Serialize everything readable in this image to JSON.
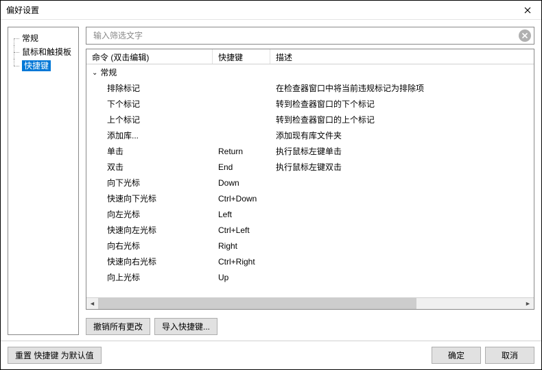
{
  "window": {
    "title": "偏好设置"
  },
  "sidebar": {
    "items": [
      {
        "label": "常规"
      },
      {
        "label": "鼠标和触摸板"
      },
      {
        "label": "快捷键"
      }
    ],
    "selected_index": 2
  },
  "search": {
    "placeholder": "输入筛选文字",
    "value": ""
  },
  "table": {
    "headers": {
      "command": "命令 (双击编辑)",
      "shortcut": "快捷键",
      "description": "描述"
    },
    "group": {
      "label": "常规",
      "expanded": true
    },
    "rows": [
      {
        "command": "排除标记",
        "shortcut": "",
        "description": "在检查器窗口中将当前违规标记为排除项"
      },
      {
        "command": "下个标记",
        "shortcut": "",
        "description": "转到检查器窗口的下个标记"
      },
      {
        "command": "上个标记",
        "shortcut": "",
        "description": "转到检查器窗口的上个标记"
      },
      {
        "command": "添加库...",
        "shortcut": "",
        "description": "添加现有库文件夹"
      },
      {
        "command": "单击",
        "shortcut": "Return",
        "description": "执行鼠标左键单击"
      },
      {
        "command": "双击",
        "shortcut": "End",
        "description": "执行鼠标左键双击"
      },
      {
        "command": "向下光标",
        "shortcut": "Down",
        "description": ""
      },
      {
        "command": "快速向下光标",
        "shortcut": "Ctrl+Down",
        "description": ""
      },
      {
        "command": "向左光标",
        "shortcut": "Left",
        "description": ""
      },
      {
        "command": "快速向左光标",
        "shortcut": "Ctrl+Left",
        "description": ""
      },
      {
        "command": "向右光标",
        "shortcut": "Right",
        "description": ""
      },
      {
        "command": "快速向右光标",
        "shortcut": "Ctrl+Right",
        "description": ""
      },
      {
        "command": "向上光标",
        "shortcut": "Up",
        "description": ""
      }
    ]
  },
  "buttons": {
    "undo_all": "撤销所有更改",
    "import": "导入快捷键...",
    "reset": "重置 快捷键 为默认值",
    "ok": "确定",
    "cancel": "取消"
  }
}
